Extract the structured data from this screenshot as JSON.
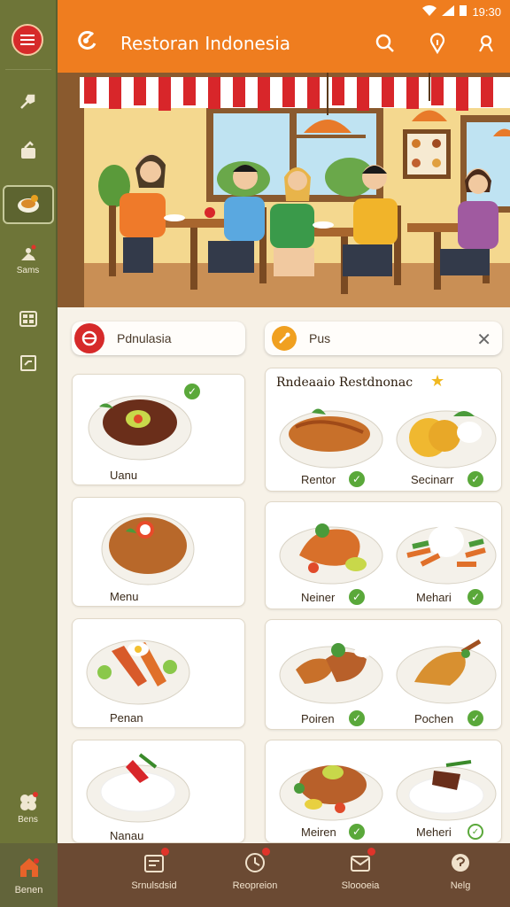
{
  "status": {
    "time": "19:30"
  },
  "header": {
    "title": "Restoran Indonesia"
  },
  "sidebar": {
    "labels": [
      "Sams",
      "Bens"
    ]
  },
  "search": {
    "left_label": "Pdnulasia",
    "right_label": "Pus"
  },
  "left_cards": [
    "Uanu",
    "Menu",
    "Penan",
    "Nanau"
  ],
  "recommended": {
    "title": "Rndeaaio Restdnonac",
    "rows": [
      [
        "Rentor",
        "Secinarr"
      ],
      [
        "Neiner",
        "Mehari"
      ],
      [
        "Poiren",
        "Pochen"
      ],
      [
        "Meiren",
        "Meheri"
      ]
    ]
  },
  "bottom_nav": {
    "home": "Benen",
    "items": [
      "Srnulsdsid",
      "Reopreion",
      "Sloooeia",
      "Nelg"
    ]
  },
  "colors": {
    "header": "#ef7d1f",
    "sidebar": "#6e7538",
    "bottom_nav": "#6b4a33",
    "accent_red": "#d62a2a",
    "check": "#5aa83a"
  }
}
